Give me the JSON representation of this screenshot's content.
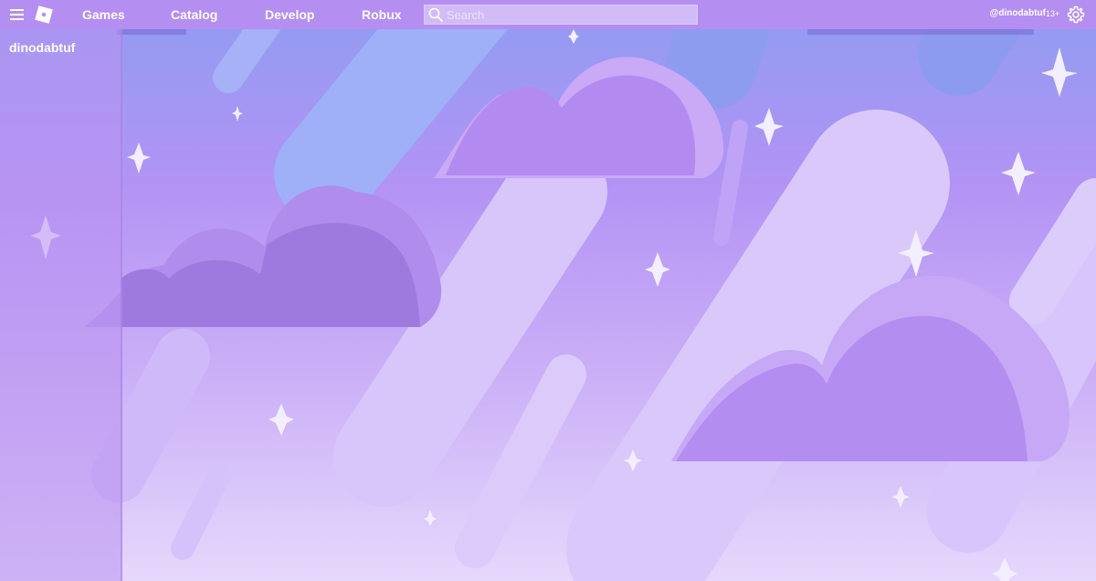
{
  "header": {
    "nav": [
      "Games",
      "Catalog",
      "Develop",
      "Robux"
    ],
    "search": {
      "placeholder": "Search",
      "value": ""
    },
    "account": {
      "username": "@dinodabtuf",
      "age_badge": "13+"
    },
    "icons": [
      "menu-icon",
      "roblox-logo",
      "search-icon",
      "gear-icon"
    ]
  },
  "sidebar": {
    "username": "dinodabtuf"
  },
  "colors": {
    "topbar": "#b48ef0",
    "sidebar": "#ba94f0",
    "sky_top": "#8fa0f2",
    "sky_bottom": "#e3d4fb",
    "cloud_dark": "#a07bdf",
    "cloud_light": "#d0b8f8",
    "sparkle": "#f2eeff"
  }
}
